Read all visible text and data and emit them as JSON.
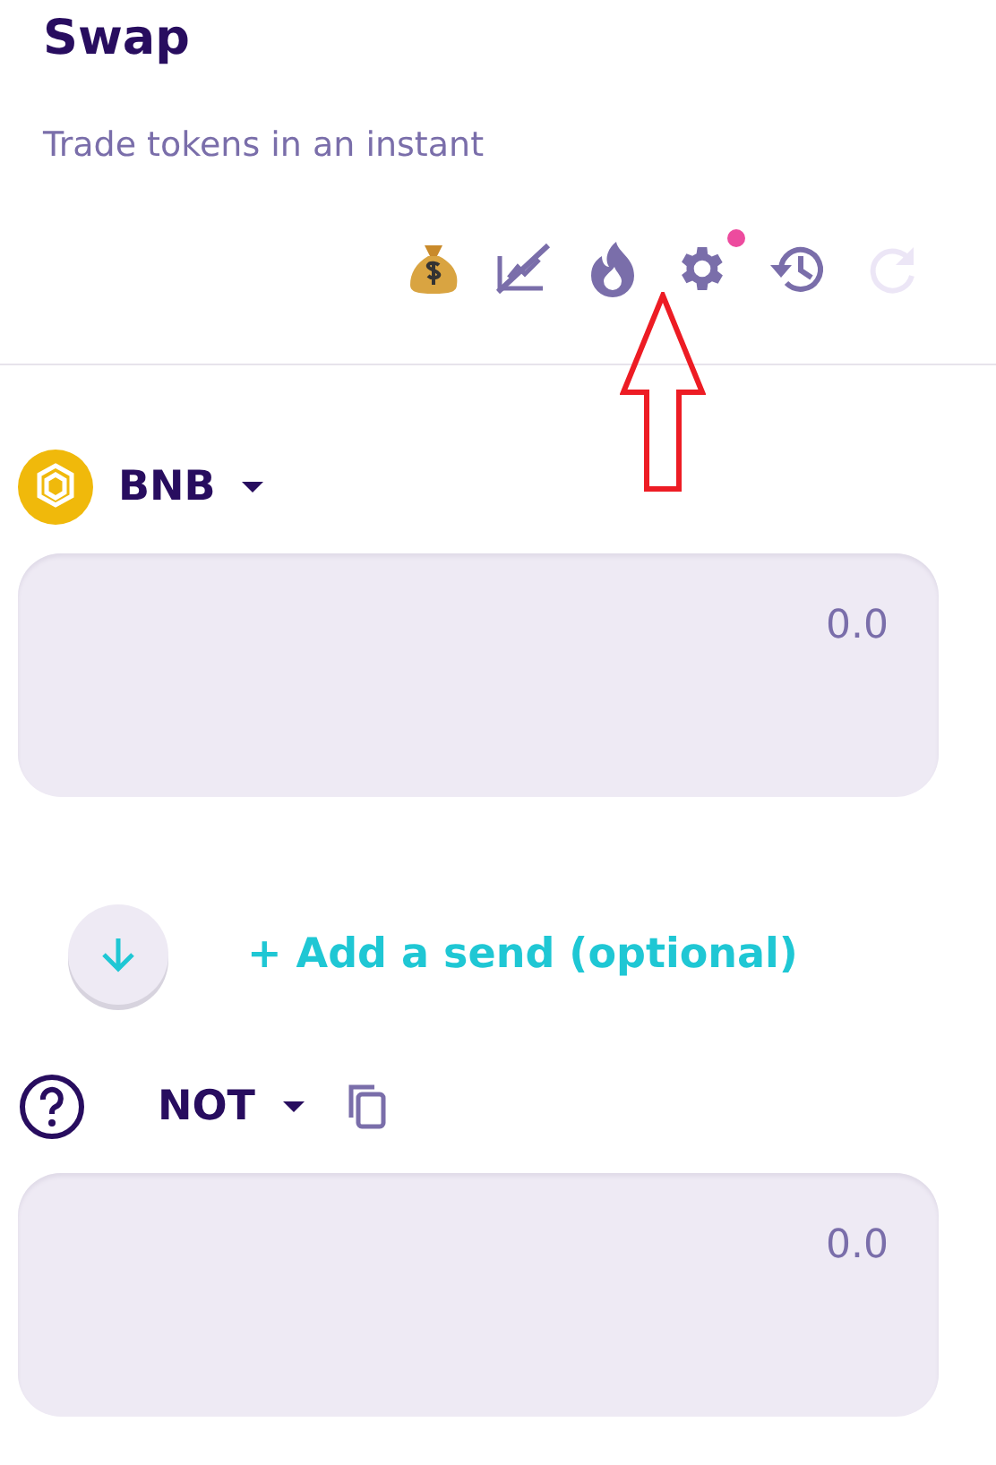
{
  "header": {
    "title": "Swap",
    "subtitle": "Trade tokens in an instant"
  },
  "toolbar": [
    {
      "kind": "bag",
      "disabled": false,
      "badge": false
    },
    {
      "kind": "chart-off",
      "disabled": false,
      "badge": false
    },
    {
      "kind": "flame",
      "disabled": false,
      "badge": false
    },
    {
      "kind": "gear",
      "disabled": false,
      "badge": true
    },
    {
      "kind": "history",
      "disabled": false,
      "badge": false
    },
    {
      "kind": "refresh",
      "disabled": true,
      "badge": false
    }
  ],
  "from": {
    "token": "BNB",
    "kind": "bnb",
    "value": "0.0"
  },
  "switch": {
    "add_send": "+ Add a send (optional)"
  },
  "to": {
    "token": "NOT",
    "kind": "unknown",
    "value": "0.0"
  }
}
